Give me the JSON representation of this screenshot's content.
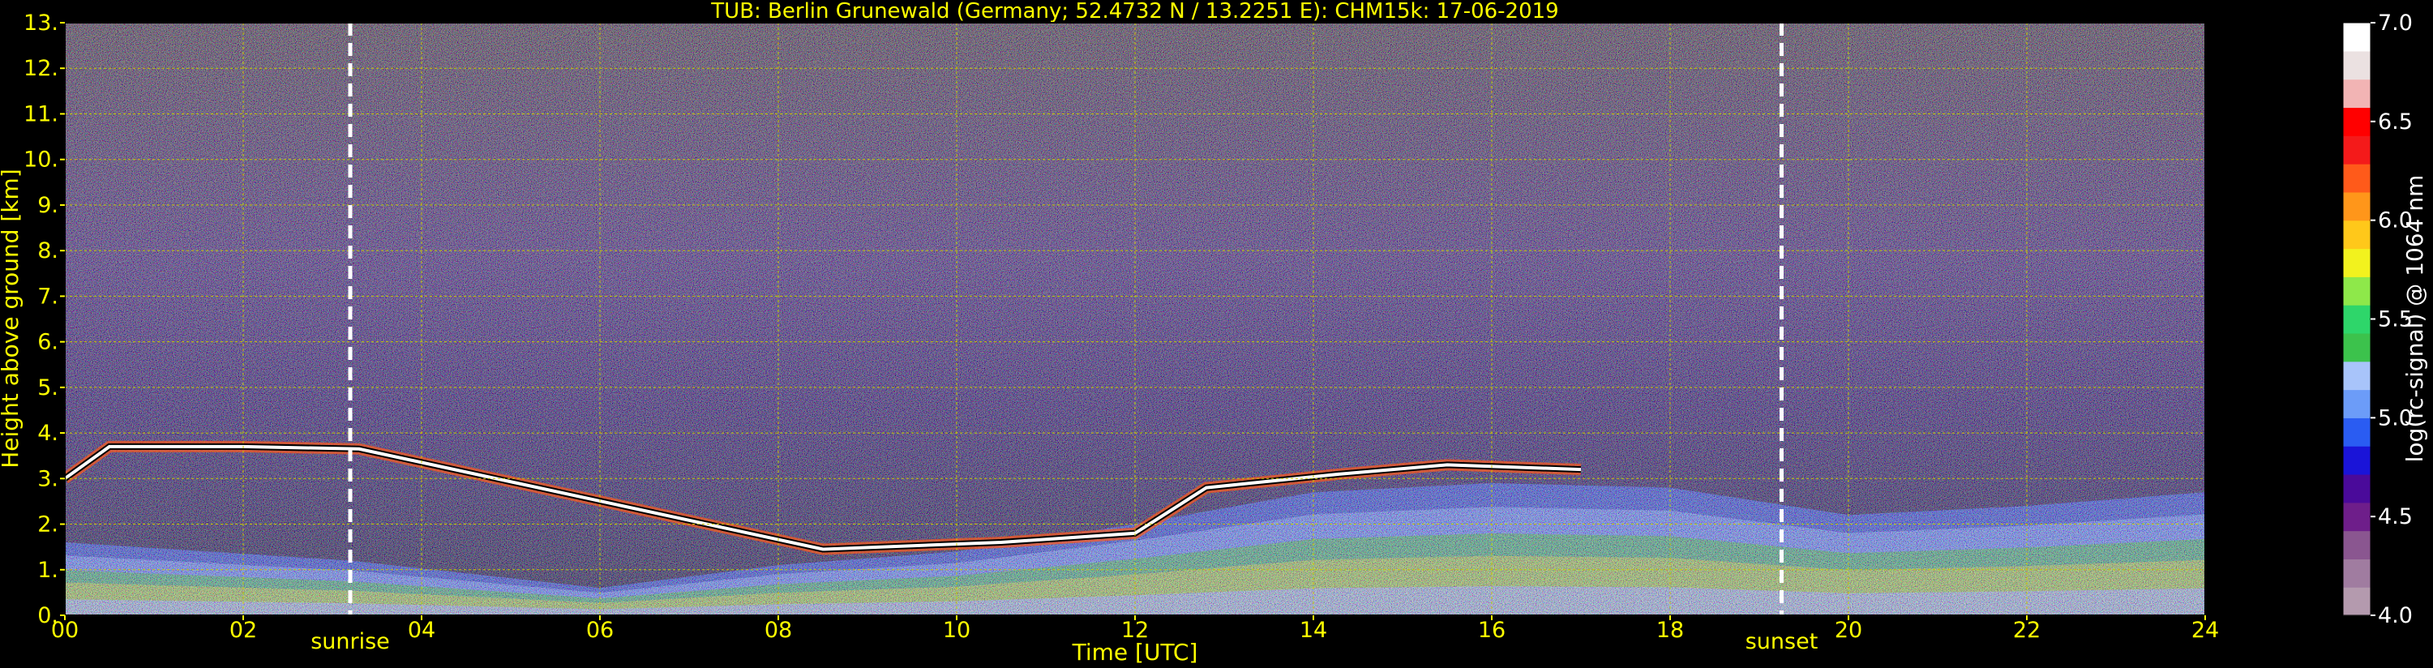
{
  "chart_data": {
    "type": "heatmap",
    "title": "TUB: Berlin Grunewald (Germany; 52.4732 N / 13.2251 E):    CHM15k: 17-06-2019",
    "xlabel": "Time [UTC]",
    "ylabel": "Height above ground [km]",
    "xlim": [
      0,
      24
    ],
    "ylim": [
      0,
      13
    ],
    "x_ticks": [
      "00",
      "02",
      "04",
      "06",
      "08",
      "10",
      "12",
      "14",
      "16",
      "18",
      "20",
      "22",
      "24"
    ],
    "y_ticks": [
      "0.",
      "1.",
      "2.",
      "3.",
      "4.",
      "5.",
      "6.",
      "7.",
      "8.",
      "9.",
      "10.",
      "11.",
      "12.",
      "13."
    ],
    "grid": true,
    "events": [
      {
        "label": "sunrise",
        "time": 3.2
      },
      {
        "label": "sunset",
        "time": 19.25
      }
    ],
    "colorbar": {
      "label": "log(rc-signal) @ 1064 nm",
      "range": [
        4.0,
        7.0
      ],
      "ticks": [
        "4.0",
        "4.5",
        "5.0",
        "5.5",
        "6.0",
        "6.5",
        "7.0"
      ],
      "colors": [
        "#b49aae",
        "#a07ca0",
        "#8a5690",
        "#6e1e8a",
        "#4a0a9a",
        "#1a14d8",
        "#2a5cf2",
        "#6c9cf8",
        "#a8c4fa",
        "#3cc24c",
        "#2ed66a",
        "#8ee84a",
        "#f2f21e",
        "#ffc81a",
        "#ff961a",
        "#ff5a1a",
        "#f41a1a",
        "#ff0000",
        "#f2b4b4",
        "#ebe1e1",
        "#ffffff"
      ]
    },
    "cloud_top_height_km": [
      {
        "time": 0.0,
        "height": 3.0
      },
      {
        "time": 0.5,
        "height": 3.7
      },
      {
        "time": 2.0,
        "height": 3.7
      },
      {
        "time": 3.3,
        "height": 3.65
      },
      {
        "time": 8.5,
        "height": 1.45
      },
      {
        "time": 10.5,
        "height": 1.6
      },
      {
        "time": 12.0,
        "height": 1.8
      },
      {
        "time": 12.8,
        "height": 2.8
      },
      {
        "time": 14.3,
        "height": 3.1
      },
      {
        "time": 15.5,
        "height": 3.3
      },
      {
        "time": 17.0,
        "height": 3.2
      }
    ],
    "boundary_layer_top_km": [
      {
        "time": 0.0,
        "height": 1.6
      },
      {
        "time": 3.2,
        "height": 1.2
      },
      {
        "time": 6.0,
        "height": 0.6
      },
      {
        "time": 8.0,
        "height": 1.1
      },
      {
        "time": 10.0,
        "height": 1.4
      },
      {
        "time": 12.0,
        "height": 2.0
      },
      {
        "time": 14.0,
        "height": 2.7
      },
      {
        "time": 16.0,
        "height": 2.9
      },
      {
        "time": 18.0,
        "height": 2.8
      },
      {
        "time": 20.0,
        "height": 2.2
      },
      {
        "time": 22.0,
        "height": 2.4
      },
      {
        "time": 24.0,
        "height": 2.7
      }
    ]
  }
}
